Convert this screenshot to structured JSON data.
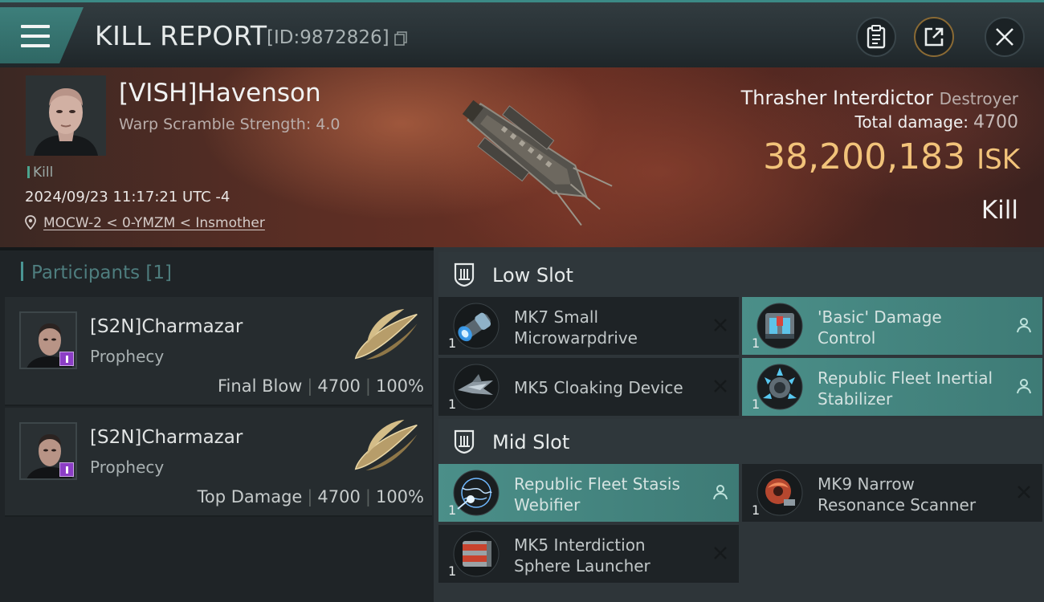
{
  "header": {
    "title": "KILL REPORT",
    "report_id": "[ID:9872826]",
    "menu_icon": "hamburger-menu-icon",
    "buttons": [
      "clipboard-icon",
      "share-icon",
      "close-icon"
    ]
  },
  "victim": {
    "name": "[VISH]Havenson",
    "warp_scramble": "Warp Scramble Strength: 4.0",
    "tag": "Kill",
    "timestamp": "2024/09/23 11:17:21 UTC -4",
    "location": "MOCW-2 < 0-YMZM < Insmother",
    "ship_name": "Thrasher Interdictor",
    "ship_class": "Destroyer",
    "total_damage_label": "Total damage:",
    "total_damage": "4700",
    "isk_value": "38,200,183",
    "isk_unit": "ISK",
    "result": "Kill"
  },
  "participants": {
    "title": "Participants [1]",
    "items": [
      {
        "name": "[S2N]Charmazar",
        "ship": "Prophecy",
        "role": "Final Blow",
        "damage": "4700",
        "percent": "100%"
      },
      {
        "name": "[S2N]Charmazar",
        "ship": "Prophecy",
        "role": "Top Damage",
        "damage": "4700",
        "percent": "100%"
      }
    ]
  },
  "slots": {
    "low": {
      "title": "Low Slot",
      "modules": [
        {
          "name": "MK7 Small Microwarpdrive",
          "qty": "1",
          "status": "destroyed"
        },
        {
          "name": "'Basic' Damage Control",
          "qty": "1",
          "status": "dropped"
        },
        {
          "name": "MK5 Cloaking Device",
          "qty": "1",
          "status": "destroyed"
        },
        {
          "name": "Republic Fleet Inertial Stabilizer",
          "qty": "1",
          "status": "dropped"
        }
      ]
    },
    "mid": {
      "title": "Mid Slot",
      "modules": [
        {
          "name": "Republic Fleet Stasis Webifier",
          "qty": "1",
          "status": "dropped"
        },
        {
          "name": "MK9 Narrow Resonance Scanner",
          "qty": "1",
          "status": "destroyed"
        },
        {
          "name": "MK5 Interdiction Sphere Launcher",
          "qty": "1",
          "status": "destroyed"
        }
      ]
    }
  },
  "colors": {
    "accent_teal": "#3d7f7b",
    "isk_gold": "#f2c37a",
    "fitted_module": "#4b8f89"
  }
}
